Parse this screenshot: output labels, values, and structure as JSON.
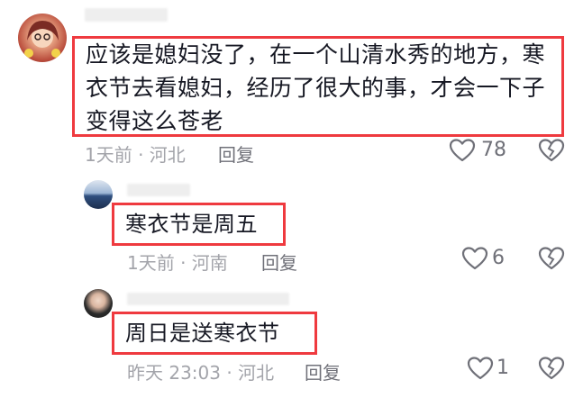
{
  "colors": {
    "highlight": "#ef3a3f",
    "meta_text": "#a3a4aa",
    "icon": "#6f7078"
  },
  "comments": [
    {
      "text": "应该是媳妇没了，在一个山清水秀的地方，寒衣节去看媳妇，经历了很大的事，才会一下子变得这么苍老",
      "line1": "应该是媳妇没了，在一个山清水秀的地方，寒",
      "line2": "衣节去看媳妇，经历了很大的事，才会一下子",
      "line3": "变得这么苍老",
      "time_location": "1天前 · 河北",
      "reply_label": "回复",
      "likes": "78",
      "like_icon": "heart-outline-icon",
      "dislike_icon": "broken-heart-icon"
    },
    {
      "text": "寒衣节是周五",
      "time_location": "1天前 · 河南",
      "reply_label": "回复",
      "likes": "6"
    },
    {
      "text": "周日是送寒衣节",
      "time_location": "昨天 23:03 · 河北",
      "reply_label": "回复",
      "likes": "1"
    }
  ]
}
